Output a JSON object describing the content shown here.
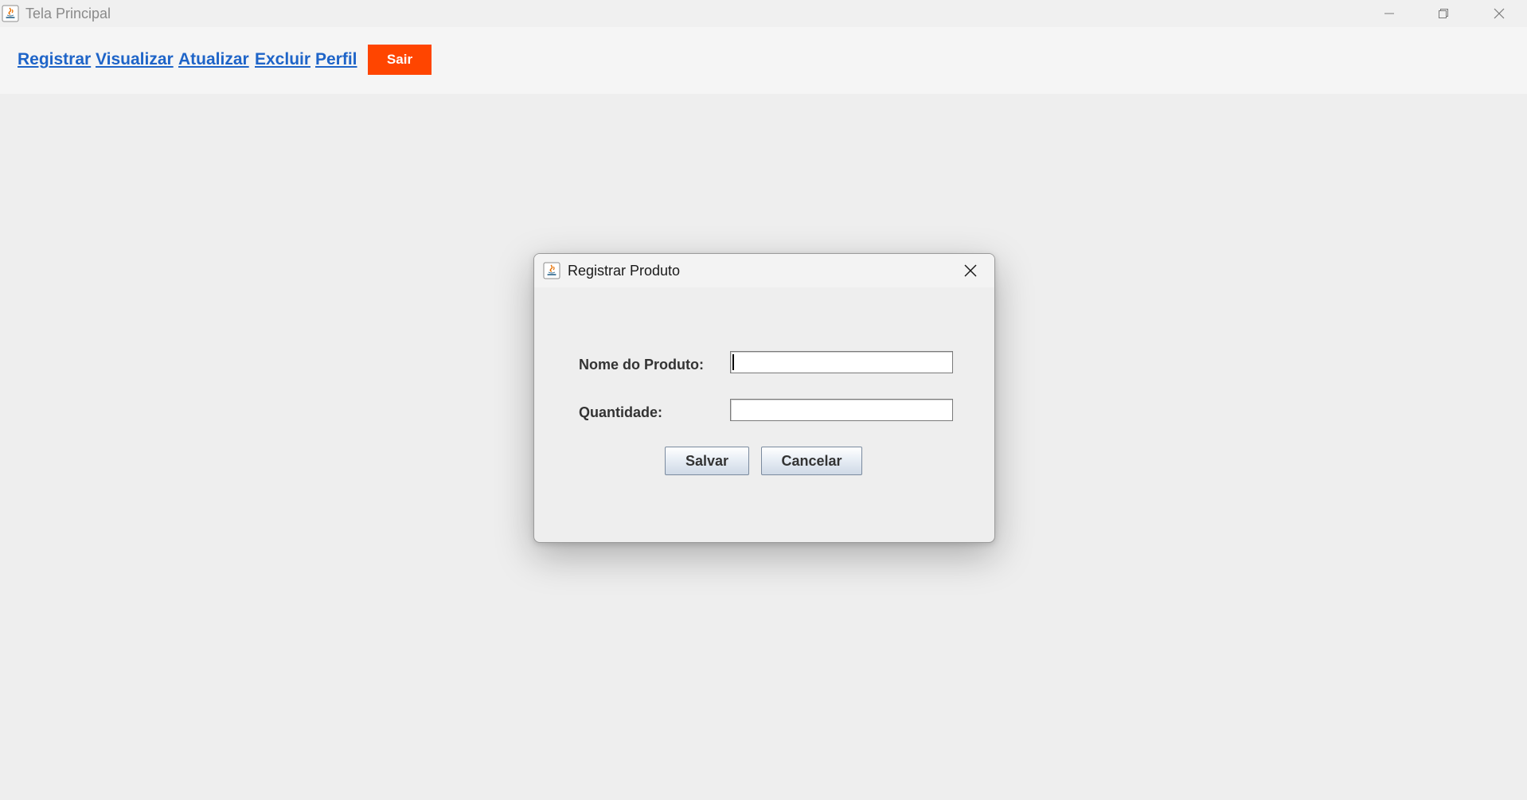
{
  "window": {
    "title": "Tela Principal",
    "controls": {
      "minimize_icon": "minimize-icon",
      "restore_icon": "restore-icon",
      "close_icon": "close-icon"
    }
  },
  "menu": {
    "items": [
      {
        "label": "Registrar"
      },
      {
        "label": "Visualizar"
      },
      {
        "label": "Atualizar"
      },
      {
        "label": "Excluir"
      },
      {
        "label": "Perfil"
      }
    ],
    "exit_label": "Sair",
    "link_color": "#1e64c8",
    "exit_color": "#ff4500"
  },
  "dialog": {
    "title": "Registrar Produto",
    "fields": {
      "nome_label": "Nome do Produto:",
      "nome_value": "",
      "quantidade_label": "Quantidade:",
      "quantidade_value": ""
    },
    "buttons": {
      "save_label": "Salvar",
      "cancel_label": "Cancelar"
    }
  }
}
